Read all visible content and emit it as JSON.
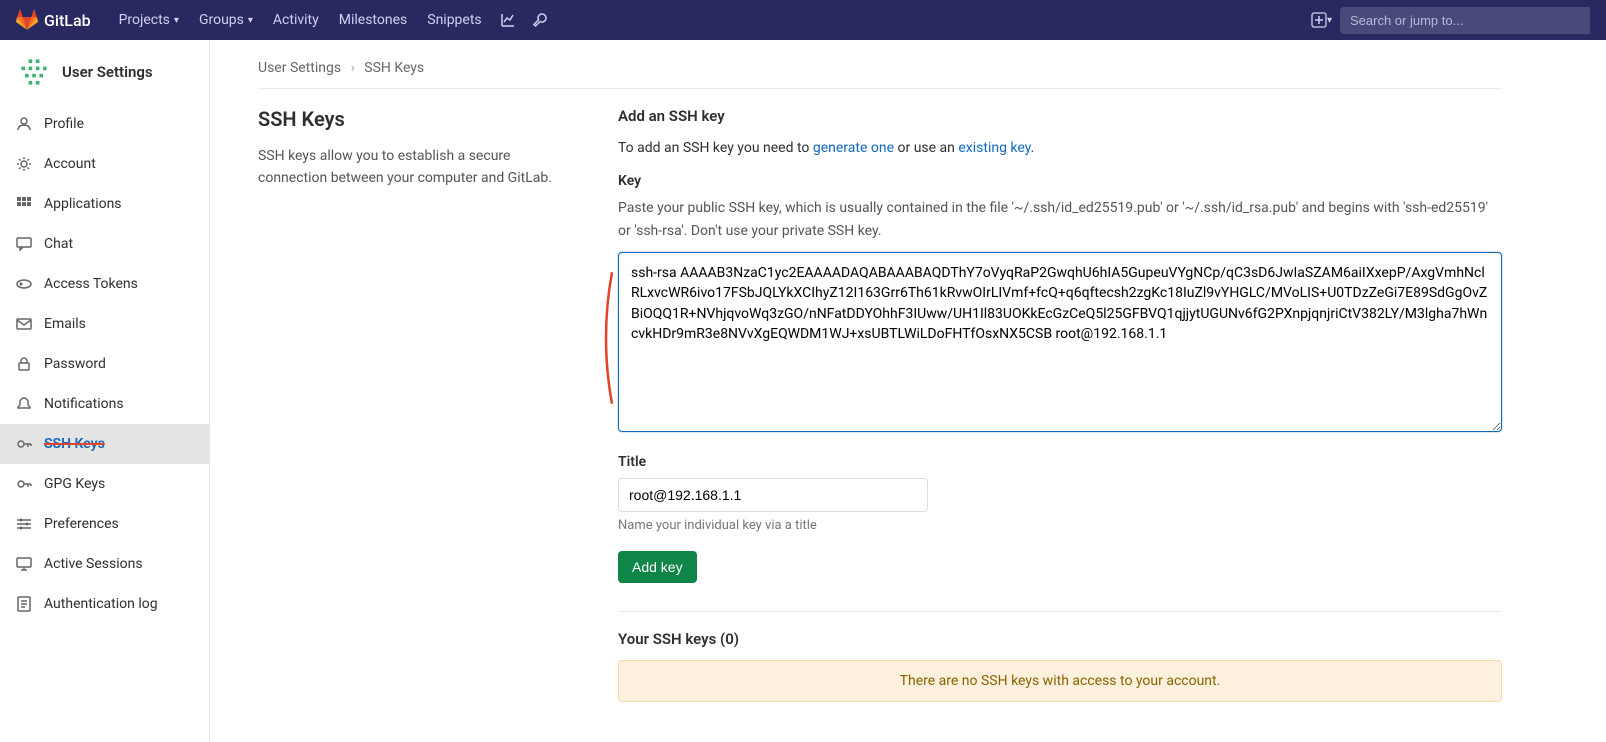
{
  "topnav": {
    "brand": "GitLab",
    "items": [
      "Projects",
      "Groups",
      "Activity",
      "Milestones",
      "Snippets"
    ],
    "search_placeholder": "Search or jump to..."
  },
  "sidebar": {
    "title": "User Settings",
    "items": [
      {
        "icon": "profile",
        "label": "Profile"
      },
      {
        "icon": "account",
        "label": "Account"
      },
      {
        "icon": "apps",
        "label": "Applications"
      },
      {
        "icon": "chat",
        "label": "Chat"
      },
      {
        "icon": "token",
        "label": "Access Tokens"
      },
      {
        "icon": "emails",
        "label": "Emails"
      },
      {
        "icon": "password",
        "label": "Password"
      },
      {
        "icon": "notif",
        "label": "Notifications"
      },
      {
        "icon": "key",
        "label": "SSH Keys"
      },
      {
        "icon": "key",
        "label": "GPG Keys"
      },
      {
        "icon": "prefs",
        "label": "Preferences"
      },
      {
        "icon": "sessions",
        "label": "Active Sessions"
      },
      {
        "icon": "log",
        "label": "Authentication log"
      }
    ],
    "active_index": 8
  },
  "breadcrumb": {
    "root": "User Settings",
    "leaf": "SSH Keys"
  },
  "intro": {
    "heading": "SSH Keys",
    "text": "SSH keys allow you to establish a secure connection between your computer and GitLab."
  },
  "form": {
    "add_heading": "Add an SSH key",
    "add_text_prefix": "To add an SSH key you need to ",
    "generate_link": "generate one",
    "add_text_mid": " or use an ",
    "existing_link": "existing key",
    "add_text_suffix": ".",
    "key_label": "Key",
    "key_help": "Paste your public SSH key, which is usually contained in the file '~/.ssh/id_ed25519.pub' or '~/.ssh/id_rsa.pub' and begins with 'ssh-ed25519' or 'ssh-rsa'. Don't use your private SSH key.",
    "key_value": "ssh-rsa AAAAB3NzaC1yc2EAAAADAQABAAABAQDThY7oVyqRaP2GwqhU6hIA5GupeuVYgNCp/qC3sD6JwIaSZAM6aiIXxepP/AxgVmhNclRLxvcWR6ivo17FSbJQLYkXCIhyZ12I163Grr6Th61kRvwOIrLIVmf+fcQ+q6qftecsh2zgKc18IuZl9vYHGLC/MVoLIS+U0TDzZeGi7E89SdGgOvZBiOQQ1R+NVhjqvoWq3zGO/nNFatDDYOhhF3IUww/UH1Il83UOKkEcGzCeQ5l25GFBVQ1qjjytUGUNv6fG2PXnpjqnjriCtV382LY/M3lgha7hWncvkHDr9mR3e8NVvXgEQWDM1WJ+xsUBTLWiLDoFHTfOsxNX5CSB root@192.168.1.1",
    "title_label": "Title",
    "title_value": "root@192.168.1.1",
    "title_hint": "Name your individual key via a title",
    "submit": "Add key"
  },
  "keys_list": {
    "heading": "Your SSH keys (0)",
    "empty": "There are no SSH keys with access to your account."
  }
}
